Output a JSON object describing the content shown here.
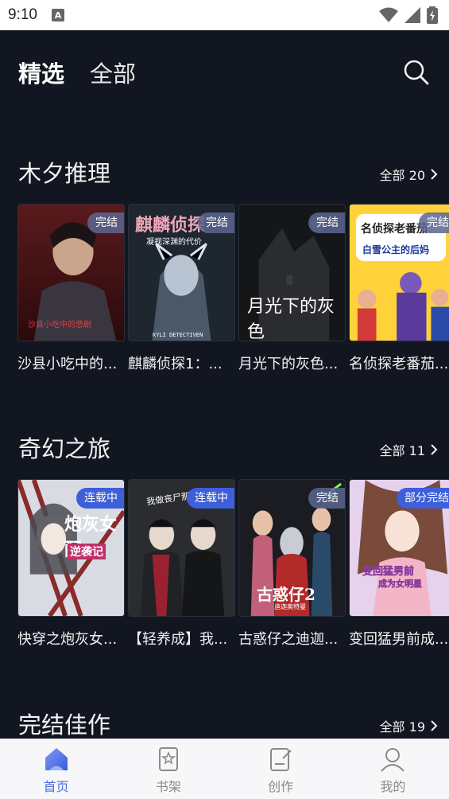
{
  "status": {
    "time": "9:10",
    "notif_letter": "A"
  },
  "tabs": [
    {
      "label": "精选"
    },
    {
      "label": "全部"
    }
  ],
  "sections": [
    {
      "title": "木夕推理",
      "all_label": "全部 20",
      "items": [
        {
          "title": "沙县小吃中的...",
          "badge": "完结",
          "cover_text": "沙县小吃中的悲剧"
        },
        {
          "title": "麒麟侦探1：...",
          "badge": "完结",
          "cover_text": "麒麟侦探",
          "cover_sub": "凝视深渊的代价",
          "cover_en": "KYLI DETECTIVEN"
        },
        {
          "title": "月光下的灰色...",
          "badge": "完结",
          "cover_text": "月光下的灰色"
        },
        {
          "title": "名侦探老番茄...",
          "badge": "完结",
          "cover_text": "名侦探老番茄",
          "cover_sub": "白雪公主的后妈"
        }
      ]
    },
    {
      "title": "奇幻之旅",
      "all_label": "全部 11",
      "items": [
        {
          "title": "快穿之炮灰女...",
          "badge": "连载中",
          "cover_text": "炮灰女配",
          "cover_sub": "逆袭记"
        },
        {
          "title": "【轻养成】我...",
          "badge": "连载中",
          "cover_text": "我做丧尸那些年"
        },
        {
          "title": "古惑仔之迪迦...",
          "badge": "完结",
          "cover_text": "古惑仔2",
          "cover_sub": "迪迦奥特曼"
        },
        {
          "title": "变回猛男前成...",
          "badge": "部分完结",
          "cover_text": "变回猛男前",
          "cover_sub": "成为女明星"
        }
      ]
    },
    {
      "title": "完结佳作",
      "all_label": "全部 19"
    }
  ],
  "nav": [
    {
      "label": "首页",
      "icon": "home-icon"
    },
    {
      "label": "书架",
      "icon": "bookshelf-icon"
    },
    {
      "label": "创作",
      "icon": "create-icon"
    },
    {
      "label": "我的",
      "icon": "profile-icon"
    }
  ],
  "colors": {
    "accent": "#4a6bdf",
    "background": "#111620",
    "badge_ongoing": "#3d5fd9"
  }
}
